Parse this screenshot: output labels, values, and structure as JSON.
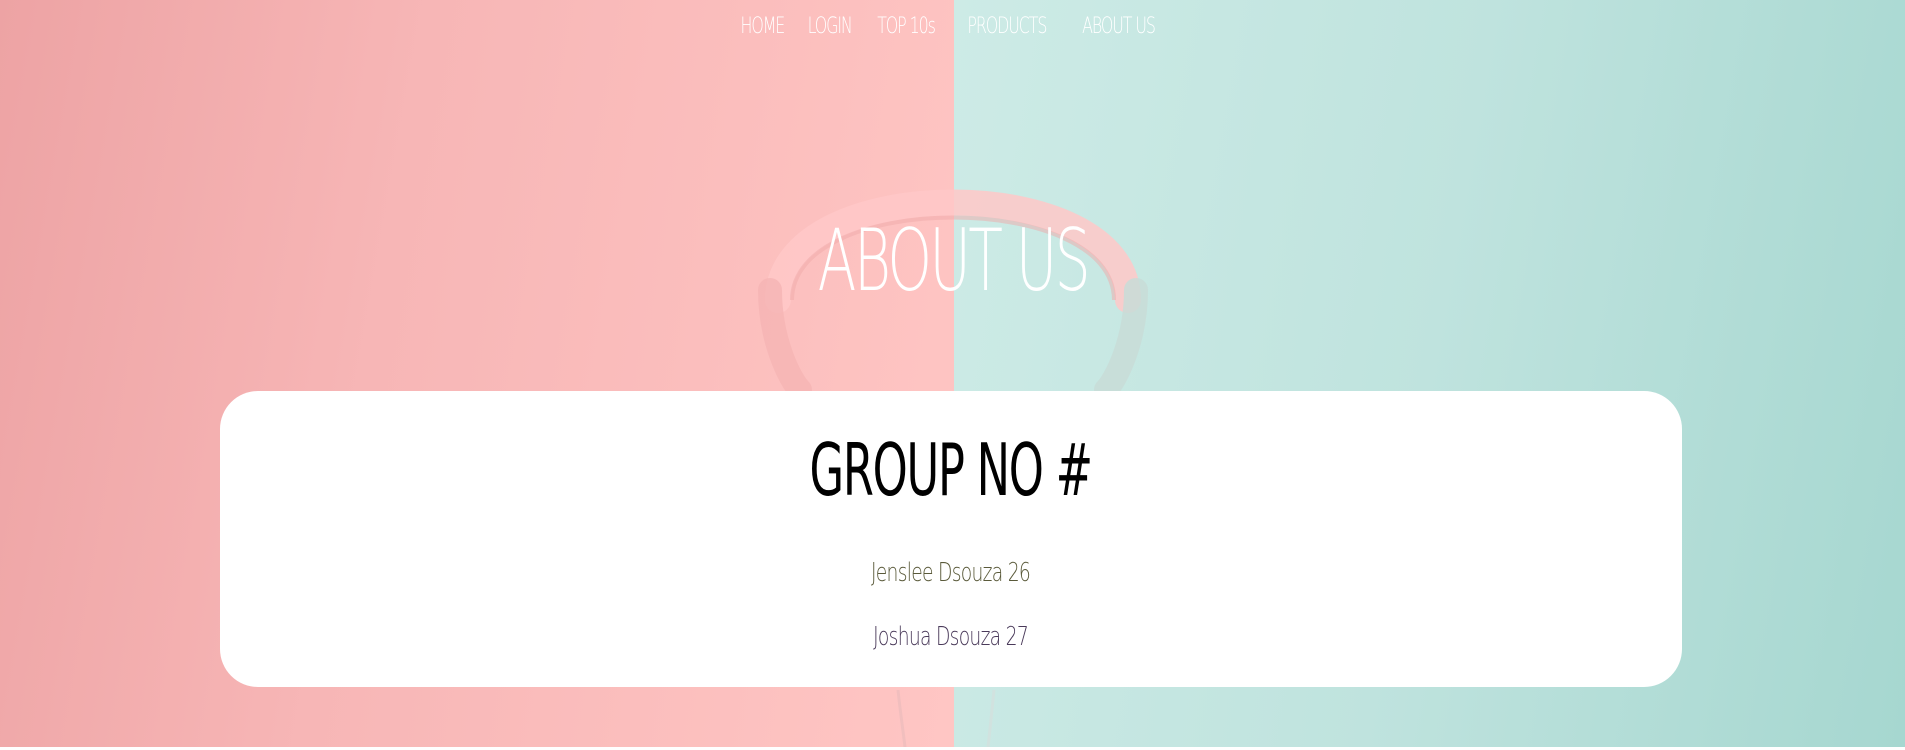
{
  "nav": {
    "items": [
      {
        "label": "HOME"
      },
      {
        "label": "LOGIN"
      },
      {
        "label": "TOP 10s"
      },
      {
        "label": "PRODUCTS"
      },
      {
        "label": "ABOUT US"
      }
    ]
  },
  "hero": {
    "title": "ABOUT US",
    "colors": {
      "left_bg": "#f7b6b6",
      "right_bg": "#bfe3de"
    }
  },
  "card": {
    "heading": "GROUP NO #",
    "members": [
      {
        "text": "Jenslee Dsouza 26"
      },
      {
        "text": "Joshua Dsouza 27"
      }
    ]
  }
}
